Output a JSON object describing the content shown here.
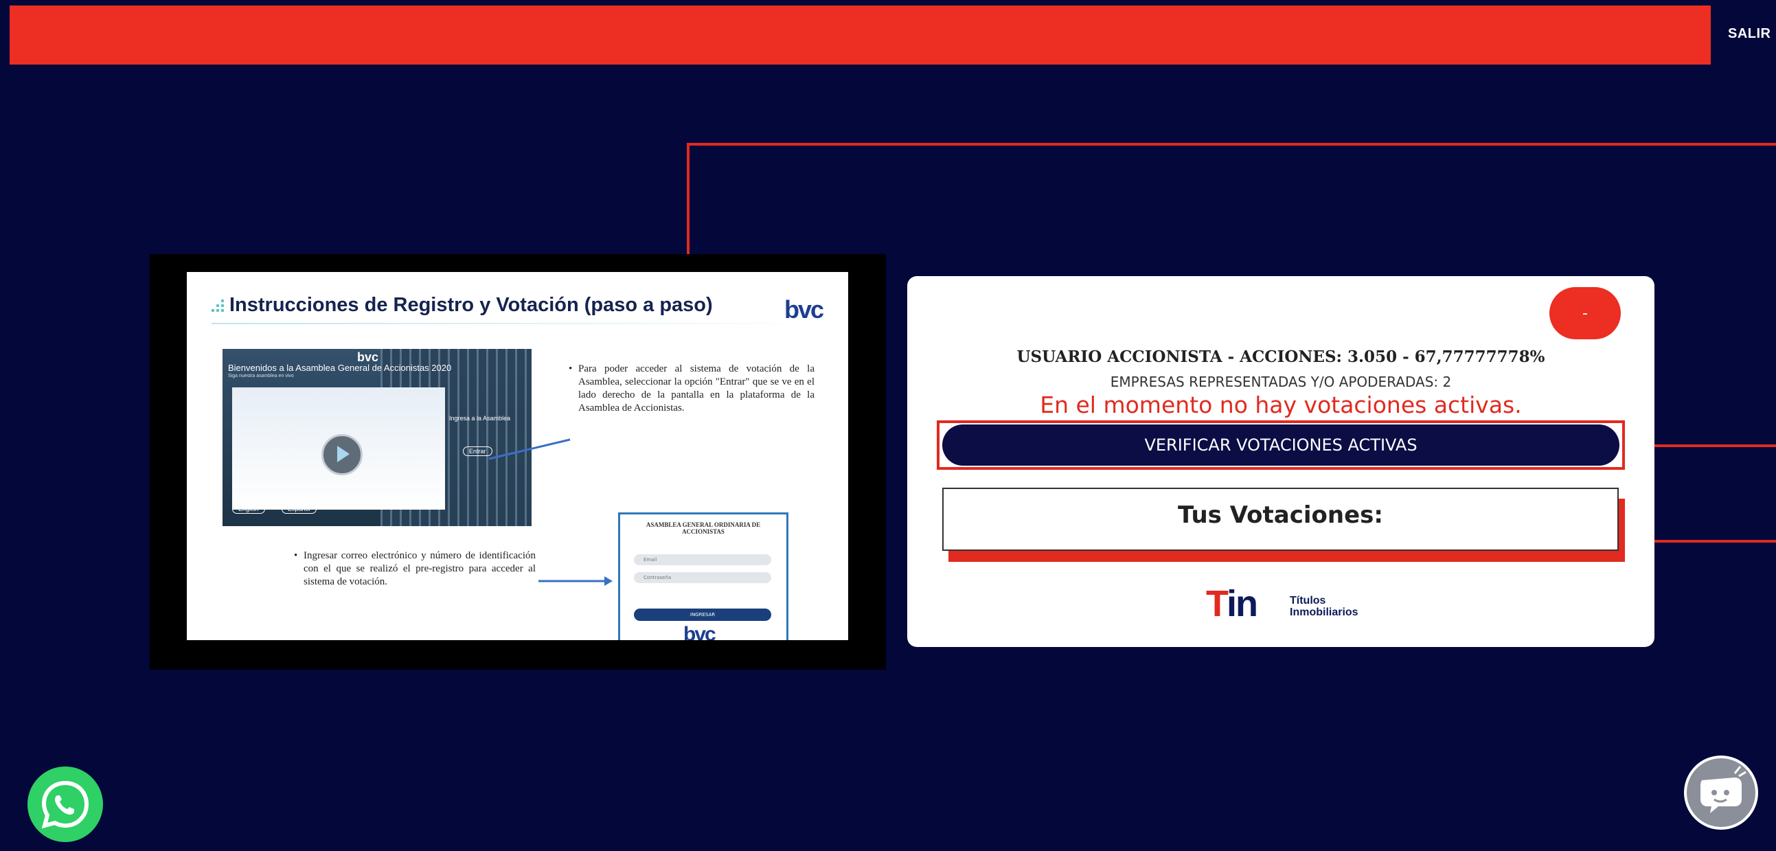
{
  "header": {
    "exit_label": "SALIR"
  },
  "video": {
    "slide_title": "Instrucciones de Registro y Votación (paso a paso)",
    "logo_text": "bvc",
    "screenshot": {
      "welcome_text": "Bienvenidos a la Asamblea General de Accionistas 2020",
      "sub_text": "Siga nuestra asamblea en vivo",
      "ingresa_text": "Ingresa a la Asamblea",
      "entrar_label": "Entrar",
      "lang_english": "English",
      "lang_spanish": "Español"
    },
    "bullet_1": "Para poder acceder al sistema de votación de la Asamblea, seleccionar la opción \"Entrar\" que se ve en el lado derecho de la pantalla en la plataforma de la Asamblea de Accionistas.",
    "bullet_2": "Ingresar correo electrónico y número de identificación con el que se realizó el pre-registro para acceder al sistema de votación.",
    "form_title": "ASAMBLEA GENERAL ORDINARIA DE ACCIONISTAS",
    "form_field_1": "Email",
    "form_field_2": "Contraseña",
    "form_button": "INGRESAR"
  },
  "card": {
    "dash_label": "-",
    "user_line": "USUARIO ACCIONISTA - ACCIONES: 3.050 - 67,77777778%",
    "empresas_line": "EMPRESAS REPRESENTADAS Y/O APODERADAS: 2",
    "status_message": "En el momento no hay votaciones activas.",
    "verify_button": "VERIFICAR VOTACIONES ACTIVAS",
    "tus_votaciones": "Tus Votaciones:",
    "logo": {
      "mark": "Tin",
      "line1": "Títulos",
      "line2": "Inmobiliarios"
    }
  },
  "floating": {
    "whatsapp_icon": "whatsapp-icon",
    "chat_icon": "chat-bot-icon"
  },
  "colors": {
    "accent_red": "#ec2e23",
    "background_navy": "#03073a",
    "whatsapp_green": "#2fd065"
  }
}
